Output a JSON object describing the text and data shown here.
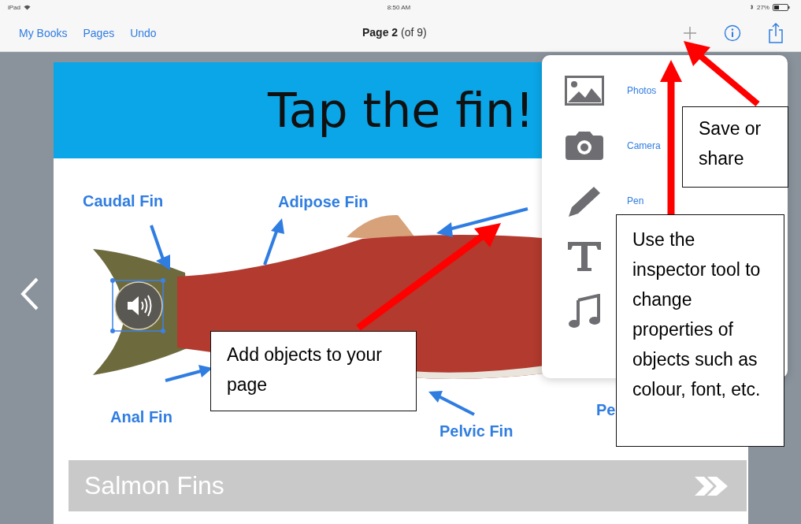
{
  "status_bar": {
    "carrier": "iPad",
    "time": "8:50 AM",
    "battery": "27%"
  },
  "nav_bar": {
    "left_buttons": [
      "My Books",
      "Pages",
      "Undo"
    ],
    "title": "Page 2",
    "subtitle": "(of 9)"
  },
  "page": {
    "title": "Tap the fin!",
    "fin_labels": [
      {
        "label": "Caudal Fin",
        "kind": "caudal"
      },
      {
        "label": "Adipose Fin",
        "kind": "adipose"
      },
      {
        "label": "Anal Fin",
        "kind": "anal"
      },
      {
        "label": "Pelvic Fin",
        "kind": "pelvic"
      },
      {
        "label": "Pe",
        "kind": "pectoral"
      }
    ],
    "sound_object": {
      "selected": true
    },
    "footer_title": "Salmon Fins"
  },
  "insert_menu": [
    {
      "kind": "photo",
      "label": "Photos"
    },
    {
      "kind": "camera",
      "label": "Camera"
    },
    {
      "kind": "pen",
      "label": "Pen"
    },
    {
      "kind": "text"
    },
    {
      "kind": "music"
    }
  ],
  "callouts": [
    {
      "kind": "share",
      "text": "Save or share"
    },
    {
      "kind": "add",
      "text": "Add objects to your page"
    },
    {
      "kind": "inspector",
      "text": "Use the inspector tool to change properties of objects such as colour, font, etc."
    }
  ]
}
